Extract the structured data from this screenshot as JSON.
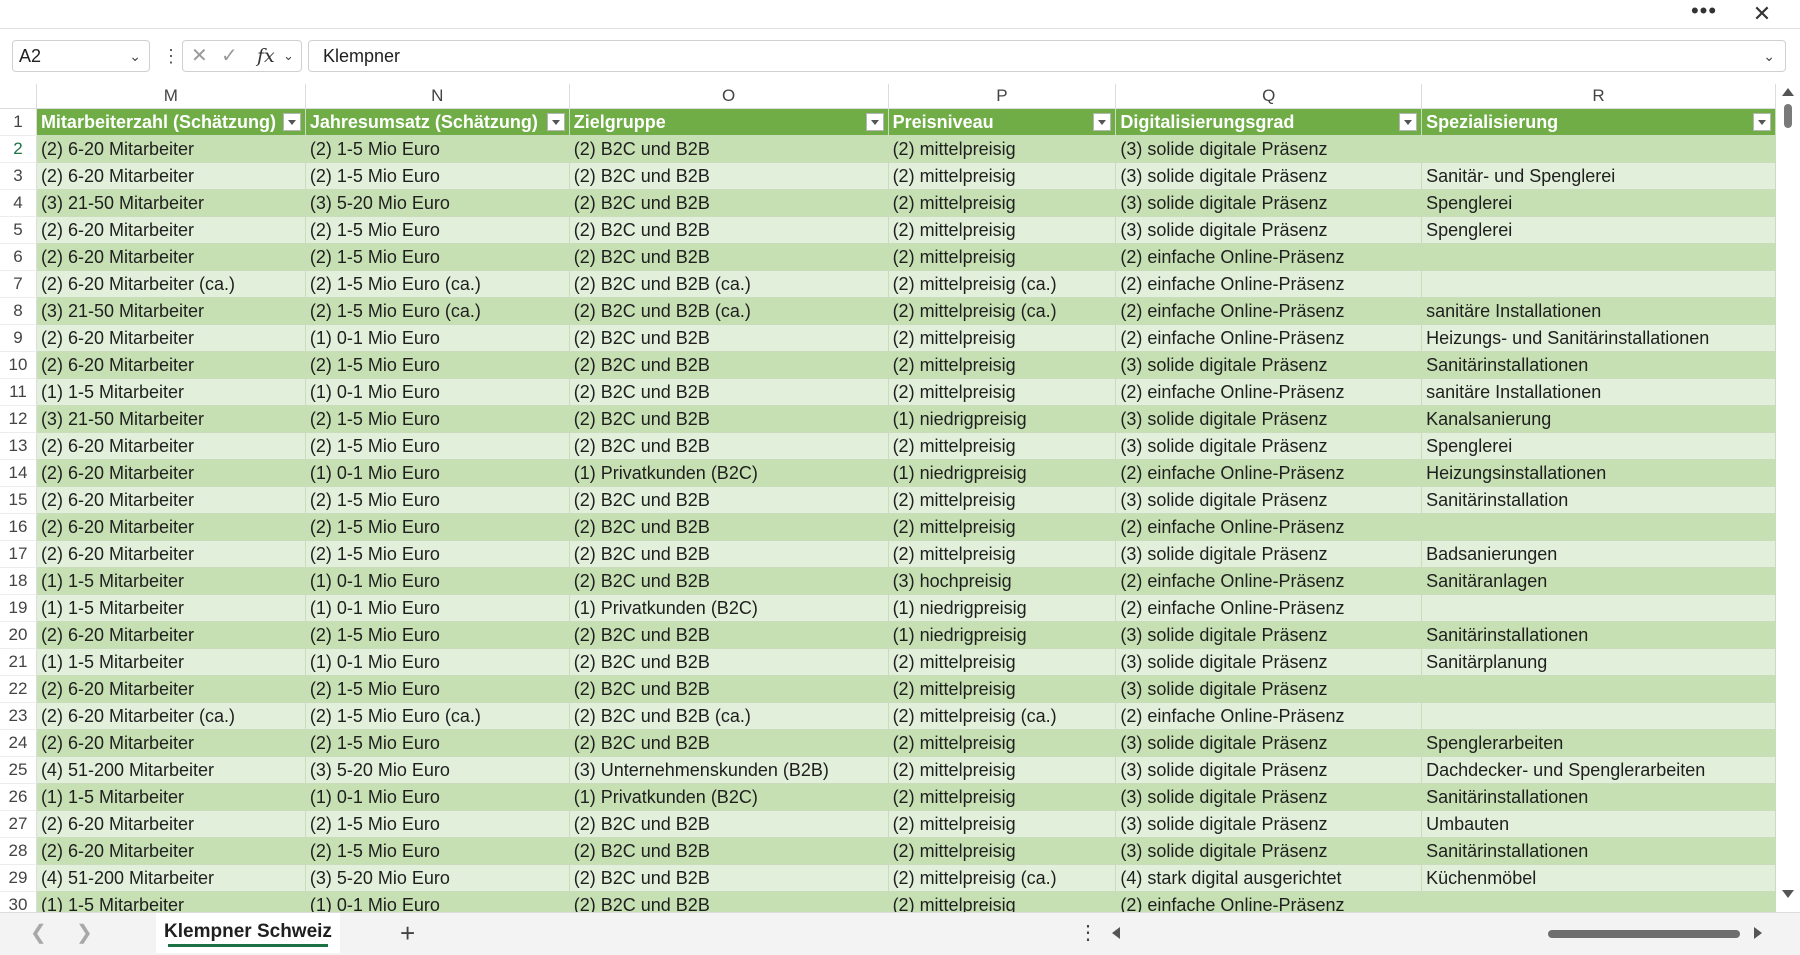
{
  "window": {
    "more_icon": "more-horizontal-icon",
    "close_icon": "close-icon"
  },
  "formula_bar": {
    "name_box": "A2",
    "formula_value": "Klempner"
  },
  "columns": [
    "M",
    "N",
    "O",
    "P",
    "Q",
    "R"
  ],
  "header_row_number": "1",
  "headers": [
    "Mitarbeiterzahl (Schätzung)",
    "Jahresumsatz (Schätzung)",
    "Zielgruppe",
    "Preisniveau",
    "Digitalisierungsgrad",
    "Spezialisierung"
  ],
  "rows": [
    {
      "n": "2",
      "c": [
        "(2) 6-20 Mitarbeiter",
        "(2) 1-5 Mio Euro",
        "(2) B2C und B2B",
        "(2) mittelpreisig",
        "(3) solide digitale Präsenz",
        ""
      ]
    },
    {
      "n": "3",
      "c": [
        "(2) 6-20 Mitarbeiter",
        "(2) 1-5 Mio Euro",
        "(2) B2C und B2B",
        "(2) mittelpreisig",
        "(3) solide digitale Präsenz",
        "Sanitär- und Spenglerei"
      ]
    },
    {
      "n": "4",
      "c": [
        "(3) 21-50 Mitarbeiter",
        "(3) 5-20 Mio Euro",
        "(2) B2C und B2B",
        "(2) mittelpreisig",
        "(3) solide digitale Präsenz",
        "Spenglerei"
      ]
    },
    {
      "n": "5",
      "c": [
        "(2) 6-20 Mitarbeiter",
        "(2) 1-5 Mio Euro",
        "(2) B2C und B2B",
        "(2) mittelpreisig",
        "(3) solide digitale Präsenz",
        "Spenglerei"
      ]
    },
    {
      "n": "6",
      "c": [
        "(2) 6-20 Mitarbeiter",
        "(2) 1-5 Mio Euro",
        "(2) B2C und B2B",
        "(2) mittelpreisig",
        "(2) einfache Online-Präsenz",
        ""
      ]
    },
    {
      "n": "7",
      "c": [
        "(2) 6-20 Mitarbeiter (ca.)",
        "(2) 1-5 Mio Euro (ca.)",
        "(2) B2C und B2B (ca.)",
        "(2) mittelpreisig (ca.)",
        "(2) einfache Online-Präsenz",
        ""
      ]
    },
    {
      "n": "8",
      "c": [
        "(3) 21-50 Mitarbeiter",
        "(2) 1-5 Mio Euro (ca.)",
        "(2) B2C und B2B (ca.)",
        "(2) mittelpreisig (ca.)",
        "(2) einfache Online-Präsenz",
        "sanitäre Installationen"
      ]
    },
    {
      "n": "9",
      "c": [
        "(2) 6-20 Mitarbeiter",
        "(1) 0-1 Mio Euro",
        "(2) B2C und B2B",
        "(2) mittelpreisig",
        "(2) einfache Online-Präsenz",
        "Heizungs- und Sanitärinstallationen"
      ]
    },
    {
      "n": "10",
      "c": [
        "(2) 6-20 Mitarbeiter",
        "(2) 1-5 Mio Euro",
        "(2) B2C und B2B",
        "(2) mittelpreisig",
        "(3) solide digitale Präsenz",
        "Sanitärinstallationen"
      ]
    },
    {
      "n": "11",
      "c": [
        "(1) 1-5 Mitarbeiter",
        "(1) 0-1 Mio Euro",
        "(2) B2C und B2B",
        "(2) mittelpreisig",
        "(2) einfache Online-Präsenz",
        "sanitäre Installationen"
      ]
    },
    {
      "n": "12",
      "c": [
        "(3) 21-50 Mitarbeiter",
        "(2) 1-5 Mio Euro",
        "(2) B2C und B2B",
        "(1) niedrigpreisig",
        "(3) solide digitale Präsenz",
        "Kanalsanierung"
      ]
    },
    {
      "n": "13",
      "c": [
        "(2) 6-20 Mitarbeiter",
        "(2) 1-5 Mio Euro",
        "(2) B2C und B2B",
        "(2) mittelpreisig",
        "(3) solide digitale Präsenz",
        "Spenglerei"
      ]
    },
    {
      "n": "14",
      "c": [
        "(2) 6-20 Mitarbeiter",
        "(1) 0-1 Mio Euro",
        "(1) Privatkunden (B2C)",
        "(1) niedrigpreisig",
        "(2) einfache Online-Präsenz",
        "Heizungsinstallationen"
      ]
    },
    {
      "n": "15",
      "c": [
        "(2) 6-20 Mitarbeiter",
        "(2) 1-5 Mio Euro",
        "(2) B2C und B2B",
        "(2) mittelpreisig",
        "(3) solide digitale Präsenz",
        "Sanitärinstallation"
      ]
    },
    {
      "n": "16",
      "c": [
        "(2) 6-20 Mitarbeiter",
        "(2) 1-5 Mio Euro",
        "(2) B2C und B2B",
        "(2) mittelpreisig",
        "(2) einfache Online-Präsenz",
        ""
      ]
    },
    {
      "n": "17",
      "c": [
        "(2) 6-20 Mitarbeiter",
        "(2) 1-5 Mio Euro",
        "(2) B2C und B2B",
        "(2) mittelpreisig",
        "(3) solide digitale Präsenz",
        "Badsanierungen"
      ]
    },
    {
      "n": "18",
      "c": [
        "(1) 1-5 Mitarbeiter",
        "(1) 0-1 Mio Euro",
        "(2) B2C und B2B",
        "(3) hochpreisig",
        "(2) einfache Online-Präsenz",
        "Sanitäranlagen"
      ]
    },
    {
      "n": "19",
      "c": [
        "(1) 1-5 Mitarbeiter",
        "(1) 0-1 Mio Euro",
        "(1) Privatkunden (B2C)",
        "(1) niedrigpreisig",
        "(2) einfache Online-Präsenz",
        ""
      ]
    },
    {
      "n": "20",
      "c": [
        "(2) 6-20 Mitarbeiter",
        "(2) 1-5 Mio Euro",
        "(2) B2C und B2B",
        "(1) niedrigpreisig",
        "(3) solide digitale Präsenz",
        "Sanitärinstallationen"
      ]
    },
    {
      "n": "21",
      "c": [
        "(1) 1-5 Mitarbeiter",
        "(1) 0-1 Mio Euro",
        "(2) B2C und B2B",
        "(2) mittelpreisig",
        "(3) solide digitale Präsenz",
        "Sanitärplanung"
      ]
    },
    {
      "n": "22",
      "c": [
        "(2) 6-20 Mitarbeiter",
        "(2) 1-5 Mio Euro",
        "(2) B2C und B2B",
        "(2) mittelpreisig",
        "(3) solide digitale Präsenz",
        ""
      ]
    },
    {
      "n": "23",
      "c": [
        "(2) 6-20 Mitarbeiter (ca.)",
        "(2) 1-5 Mio Euro (ca.)",
        "(2) B2C und B2B (ca.)",
        "(2) mittelpreisig (ca.)",
        "(2) einfache Online-Präsenz",
        ""
      ]
    },
    {
      "n": "24",
      "c": [
        "(2) 6-20 Mitarbeiter",
        "(2) 1-5 Mio Euro",
        "(2) B2C und B2B",
        "(2) mittelpreisig",
        "(3) solide digitale Präsenz",
        "Spenglerarbeiten"
      ]
    },
    {
      "n": "25",
      "c": [
        "(4) 51-200 Mitarbeiter",
        "(3) 5-20 Mio Euro",
        "(3) Unternehmenskunden (B2B)",
        "(2) mittelpreisig",
        "(3) solide digitale Präsenz",
        "Dachdecker- und Spenglerarbeiten"
      ]
    },
    {
      "n": "26",
      "c": [
        "(1) 1-5 Mitarbeiter",
        "(1) 0-1 Mio Euro",
        "(1) Privatkunden (B2C)",
        "(2) mittelpreisig",
        "(3) solide digitale Präsenz",
        "Sanitärinstallationen"
      ]
    },
    {
      "n": "27",
      "c": [
        "(2) 6-20 Mitarbeiter",
        "(2) 1-5 Mio Euro",
        "(2) B2C und B2B",
        "(2) mittelpreisig",
        "(3) solide digitale Präsenz",
        "Umbauten"
      ]
    },
    {
      "n": "28",
      "c": [
        "(2) 6-20 Mitarbeiter",
        "(2) 1-5 Mio Euro",
        "(2) B2C und B2B",
        "(2) mittelpreisig",
        "(3) solide digitale Präsenz",
        "Sanitärinstallationen"
      ]
    },
    {
      "n": "29",
      "c": [
        "(4) 51-200 Mitarbeiter",
        "(3) 5-20 Mio Euro",
        "(2) B2C und B2B",
        "(2) mittelpreisig (ca.)",
        "(4) stark digital ausgerichtet",
        "Küchenmöbel"
      ]
    },
    {
      "n": "30",
      "c": [
        "(1) 1-5 Mitarbeiter",
        "(1) 0-1 Mio Euro",
        "(2) B2C und B2B",
        "(2) mittelpreisig",
        "(2) einfache Online-Präsenz",
        ""
      ]
    }
  ],
  "sheet_tabs": {
    "active": "Klempner Schweiz",
    "add_icon": "plus-icon"
  },
  "colors": {
    "header_green": "#70ad47",
    "band_dark": "#c6e0b4",
    "band_light": "#e2efda",
    "accent": "#1e7145"
  }
}
